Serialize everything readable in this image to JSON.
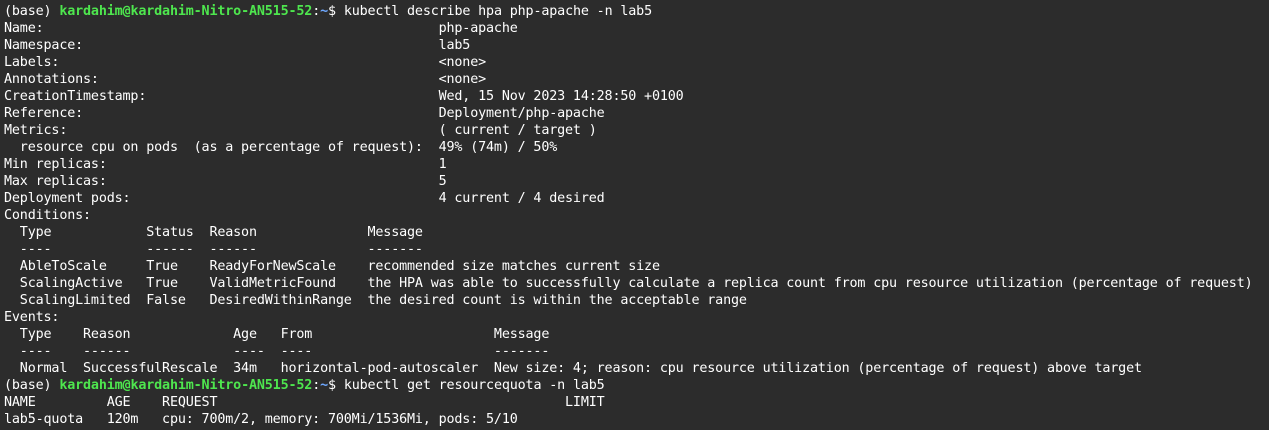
{
  "prompt": {
    "prefix": "(base) ",
    "user_host": "kardahim@kardahim-Nitro-AN515-52",
    "sep": ":",
    "path": "~",
    "symbol": "$ "
  },
  "commands": {
    "describe": "kubectl describe hpa php-apache -n lab5",
    "quota": "kubectl get resourcequota -n lab5"
  },
  "output_lines": [
    "Name:                                                  php-apache",
    "Namespace:                                             lab5",
    "Labels:                                                <none>",
    "Annotations:                                           <none>",
    "CreationTimestamp:                                     Wed, 15 Nov 2023 14:28:50 +0100",
    "Reference:                                             Deployment/php-apache",
    "Metrics:                                               ( current / target )",
    "  resource cpu on pods  (as a percentage of request):  49% (74m) / 50%",
    "Min replicas:                                          1",
    "Max replicas:                                          5",
    "Deployment pods:                                       4 current / 4 desired",
    "Conditions:",
    "  Type            Status  Reason              Message",
    "  ----            ------  ------              -------",
    "  AbleToScale     True    ReadyForNewScale    recommended size matches current size",
    "  ScalingActive   True    ValidMetricFound    the HPA was able to successfully calculate a replica count from cpu resource utilization (percentage of request)",
    "  ScalingLimited  False   DesiredWithinRange  the desired count is within the acceptable range",
    "Events:",
    "  Type    Reason             Age   From                       Message",
    "  ----    ------             ----  ----                       -------",
    "  Normal  SuccessfulRescale  34m   horizontal-pod-autoscaler  New size: 4; reason: cpu resource utilization (percentage of request) above target"
  ],
  "quota_lines": [
    "NAME         AGE    REQUEST                                            LIMIT",
    "lab5-quota   120m   cpu: 700m/2, memory: 700Mi/1536Mi, pods: 5/10"
  ]
}
